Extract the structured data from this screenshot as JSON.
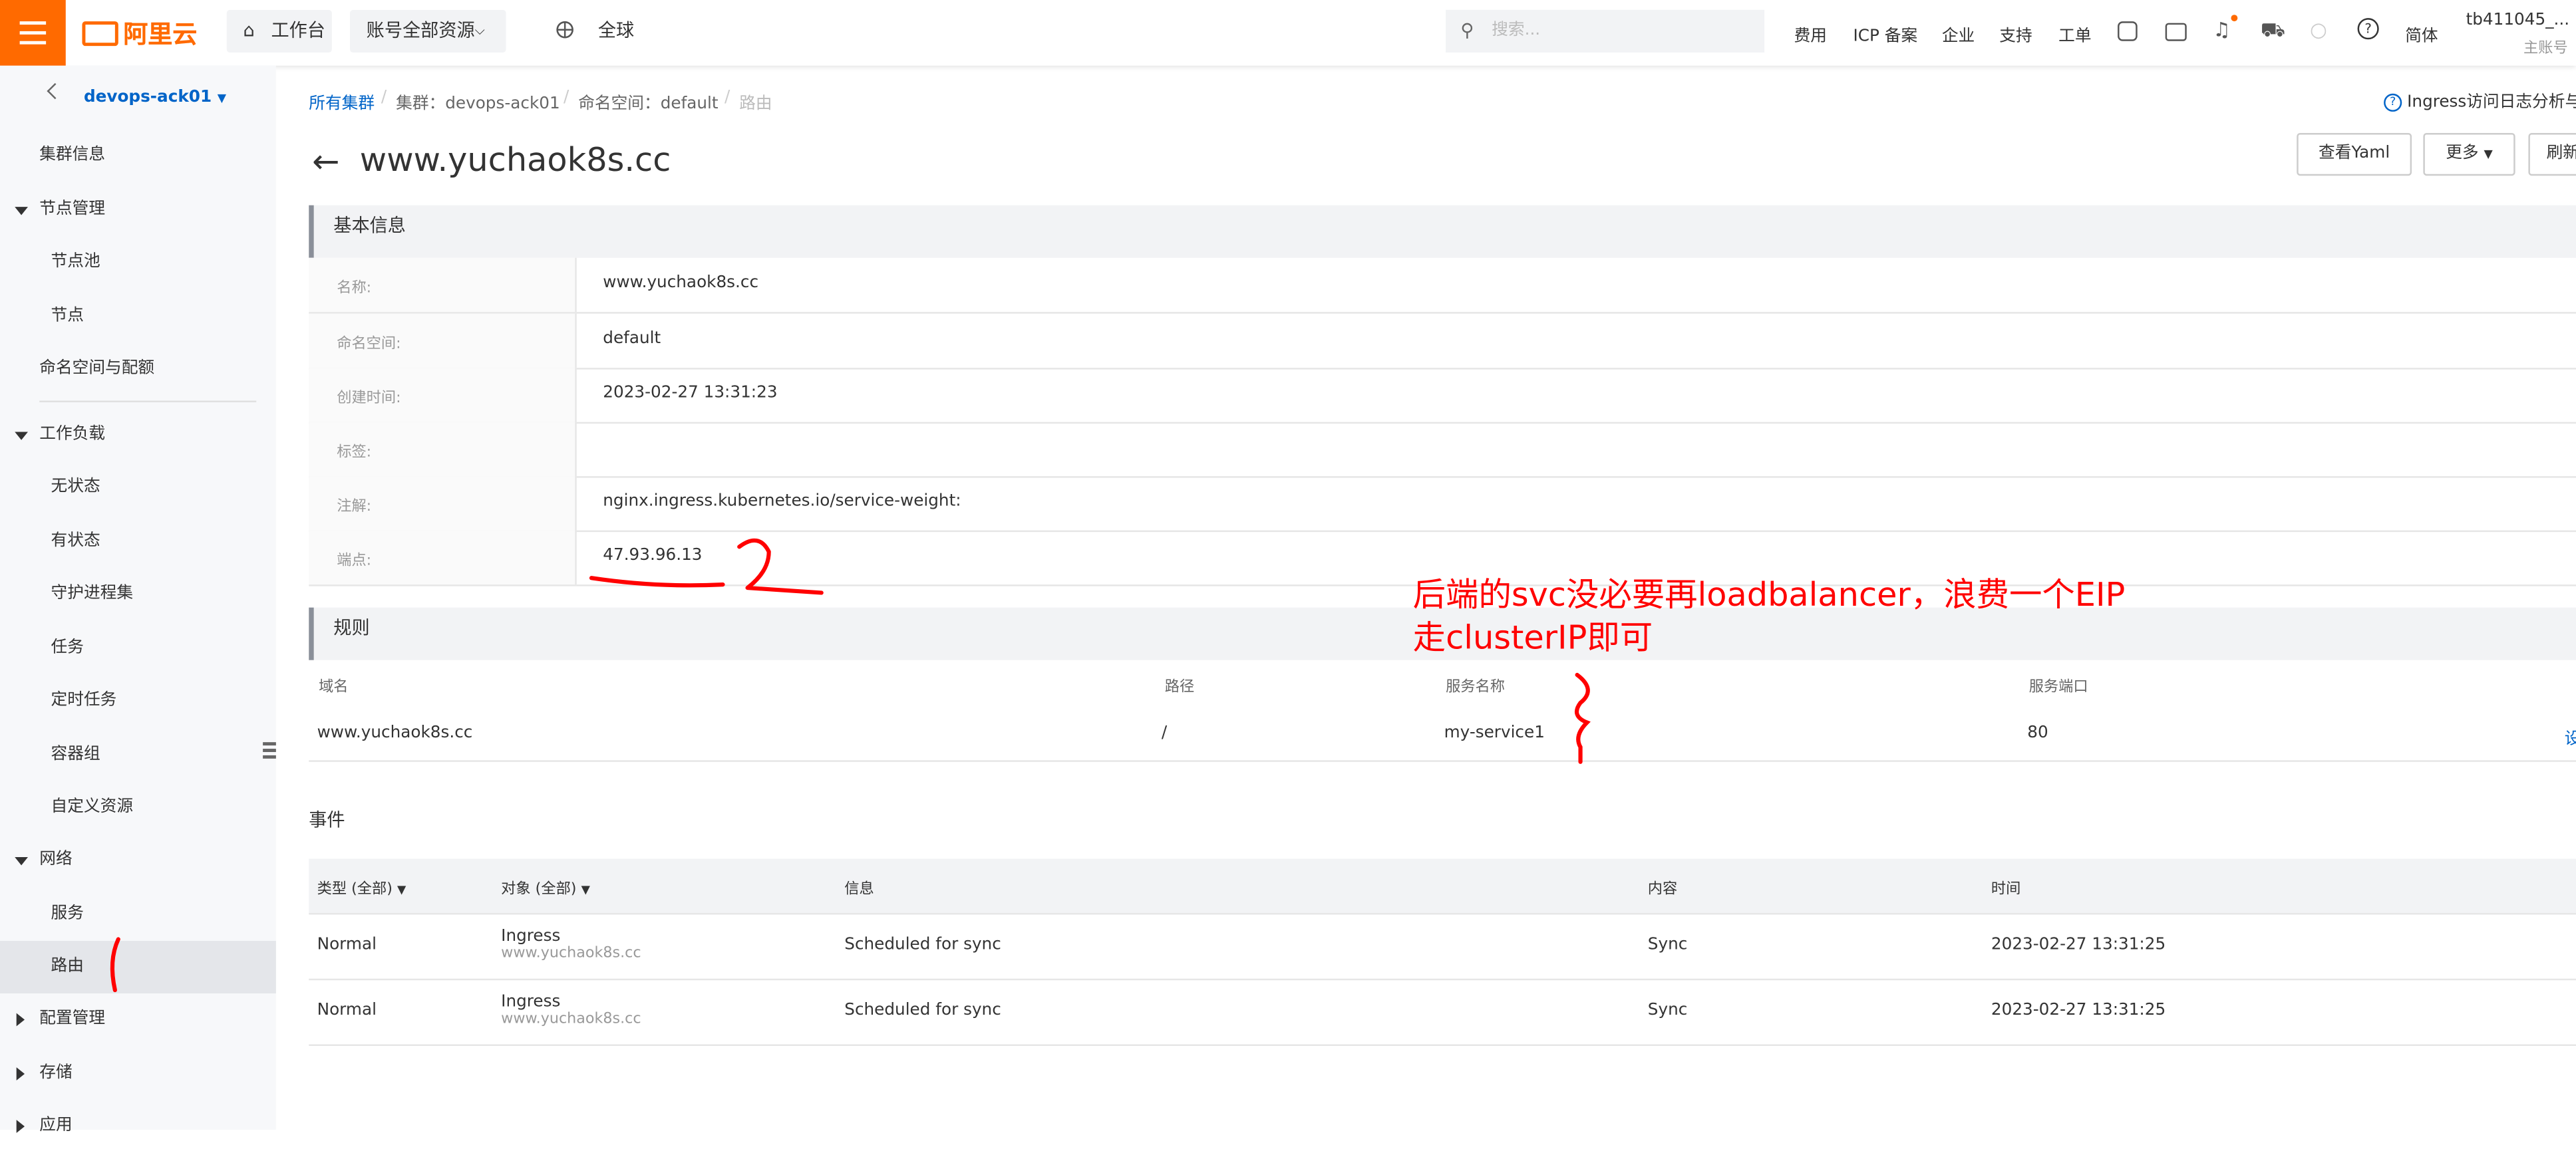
{
  "topbar": {
    "logo": "阿里云",
    "workbench": "工作台",
    "account_scope": "账号全部资源",
    "region": "全球",
    "search_placeholder": "搜索...",
    "nav": [
      "费用",
      "ICP 备案",
      "企业",
      "支持",
      "工单"
    ],
    "language": "简体",
    "user": "tb411045_...",
    "user_role": "主账号"
  },
  "sidebar": {
    "cluster": "devops-ack01",
    "items": {
      "cluster_info": "集群信息",
      "node_mgmt": "节点管理",
      "node_pool": "节点池",
      "nodes": "节点",
      "ns_quota": "命名空间与配额",
      "workloads": "工作负载",
      "stateless": "无状态",
      "stateful": "有状态",
      "daemonset": "守护进程集",
      "jobs": "任务",
      "cronjobs": "定时任务",
      "pods": "容器组",
      "crd": "自定义资源",
      "network": "网络",
      "services": "服务",
      "ingress": "路由",
      "config_mgmt": "配置管理",
      "storage": "存储",
      "apps": "应用"
    }
  },
  "breadcrumb": {
    "all_clusters": "所有集群",
    "cluster": "集群：devops-ack01",
    "namespace": "命名空间：default",
    "current": "路由"
  },
  "header": {
    "title": "www.yuchaok8s.cc",
    "log_link": "Ingress访问日志分析与监",
    "view_yaml": "查看Yaml",
    "more": "更多",
    "refresh": "刷新"
  },
  "basic_info": {
    "section_title": "基本信息",
    "labels": {
      "name": "名称:",
      "namespace": "命名空间:",
      "created": "创建时间:",
      "tags": "标签:",
      "annotations": "注解:",
      "endpoint": "端点:"
    },
    "values": {
      "name": "www.yuchaok8s.cc",
      "namespace": "default",
      "created": "2023-02-27 13:31:23",
      "tags": "",
      "annotations": "nginx.ingress.kubernetes.io/service-weight:",
      "endpoint": "47.93.96.13"
    }
  },
  "rules": {
    "section_title": "规则",
    "headers": [
      "域名",
      "路径",
      "服务名称",
      "服务端口"
    ],
    "row": {
      "domain": "www.yuchaok8s.cc",
      "path": "/",
      "service": "my-service1",
      "port": "80",
      "action": "设"
    }
  },
  "events": {
    "title": "事件",
    "headers": [
      "类型 (全部)",
      "对象 (全部)",
      "信息",
      "内容",
      "时间"
    ],
    "rows": [
      {
        "type": "Normal",
        "object": "Ingress",
        "object_name": "www.yuchaok8s.cc",
        "message": "Scheduled for sync",
        "content": "Sync",
        "time": "2023-02-27 13:31:25"
      },
      {
        "type": "Normal",
        "object": "Ingress",
        "object_name": "www.yuchaok8s.cc",
        "message": "Scheduled for sync",
        "content": "Sync",
        "time": "2023-02-27 13:31:25"
      }
    ]
  },
  "annotation_note": {
    "line1": "后端的svc没必要再loadbalancer，浪费一个EIP",
    "line2": "走clusterIP即可"
  },
  "colors": {
    "brand": "#ff6a00",
    "link": "#0064c8",
    "annotation": "#ff0000"
  }
}
